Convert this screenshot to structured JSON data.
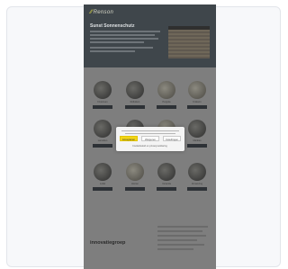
{
  "site": {
    "logo": "Renson",
    "hero_title": "Sunst Sonnenschutz",
    "footer_logo": "innovatiegroep"
  },
  "products": [
    {
      "label": "Fixscreen"
    },
    {
      "label": "Rolluiken"
    },
    {
      "label": "Pergola"
    },
    {
      "label": "Knikarm"
    },
    {
      "label": "Lamellen"
    },
    {
      "label": "Screens"
    },
    {
      "label": "Terras"
    },
    {
      "label": "Markies"
    },
    {
      "label": "Luifel"
    },
    {
      "label": "Horren"
    },
    {
      "label": "Veranda"
    },
    {
      "label": "Zonwering"
    }
  ],
  "cookie_dialog": {
    "accept_label": "Accepteren",
    "reject_label": "Weigeren",
    "settings_label": "Instellingen",
    "more_link": "Cookiebeleid en privacyverklaring"
  }
}
